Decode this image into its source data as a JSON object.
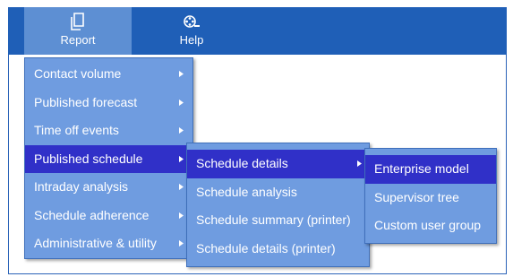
{
  "menubar": {
    "report_label": "Report",
    "help_label": "Help"
  },
  "report_menu": {
    "items": [
      {
        "label": "Contact volume",
        "has_submenu": true
      },
      {
        "label": "Published forecast",
        "has_submenu": true
      },
      {
        "label": "Time off events",
        "has_submenu": true
      },
      {
        "label": "Published schedule",
        "has_submenu": true,
        "active": true
      },
      {
        "label": "Intraday analysis",
        "has_submenu": true
      },
      {
        "label": "Schedule adherence",
        "has_submenu": true
      },
      {
        "label": "Administrative & utility",
        "has_submenu": true
      }
    ]
  },
  "schedule_menu": {
    "items": [
      {
        "label": "Schedule details",
        "has_submenu": true,
        "active": true
      },
      {
        "label": "Schedule analysis"
      },
      {
        "label": "Schedule summary (printer)"
      },
      {
        "label": "Schedule details (printer)"
      }
    ]
  },
  "details_menu": {
    "items": [
      {
        "label": "Enterprise model",
        "active": true
      },
      {
        "label": "Supervisor tree"
      },
      {
        "label": "Custom user group"
      }
    ]
  },
  "colors": {
    "menubar_bg": "#1f5fb7",
    "report_active_bg": "#5d8fd3",
    "menu_bg": "#6f9ce0",
    "menu_active_bg": "#3030c8",
    "text": "#ffffff"
  },
  "icons": {
    "report": "document-copy-icon",
    "help": "film-reel-icon",
    "submenu": "chevron-right-icon"
  }
}
